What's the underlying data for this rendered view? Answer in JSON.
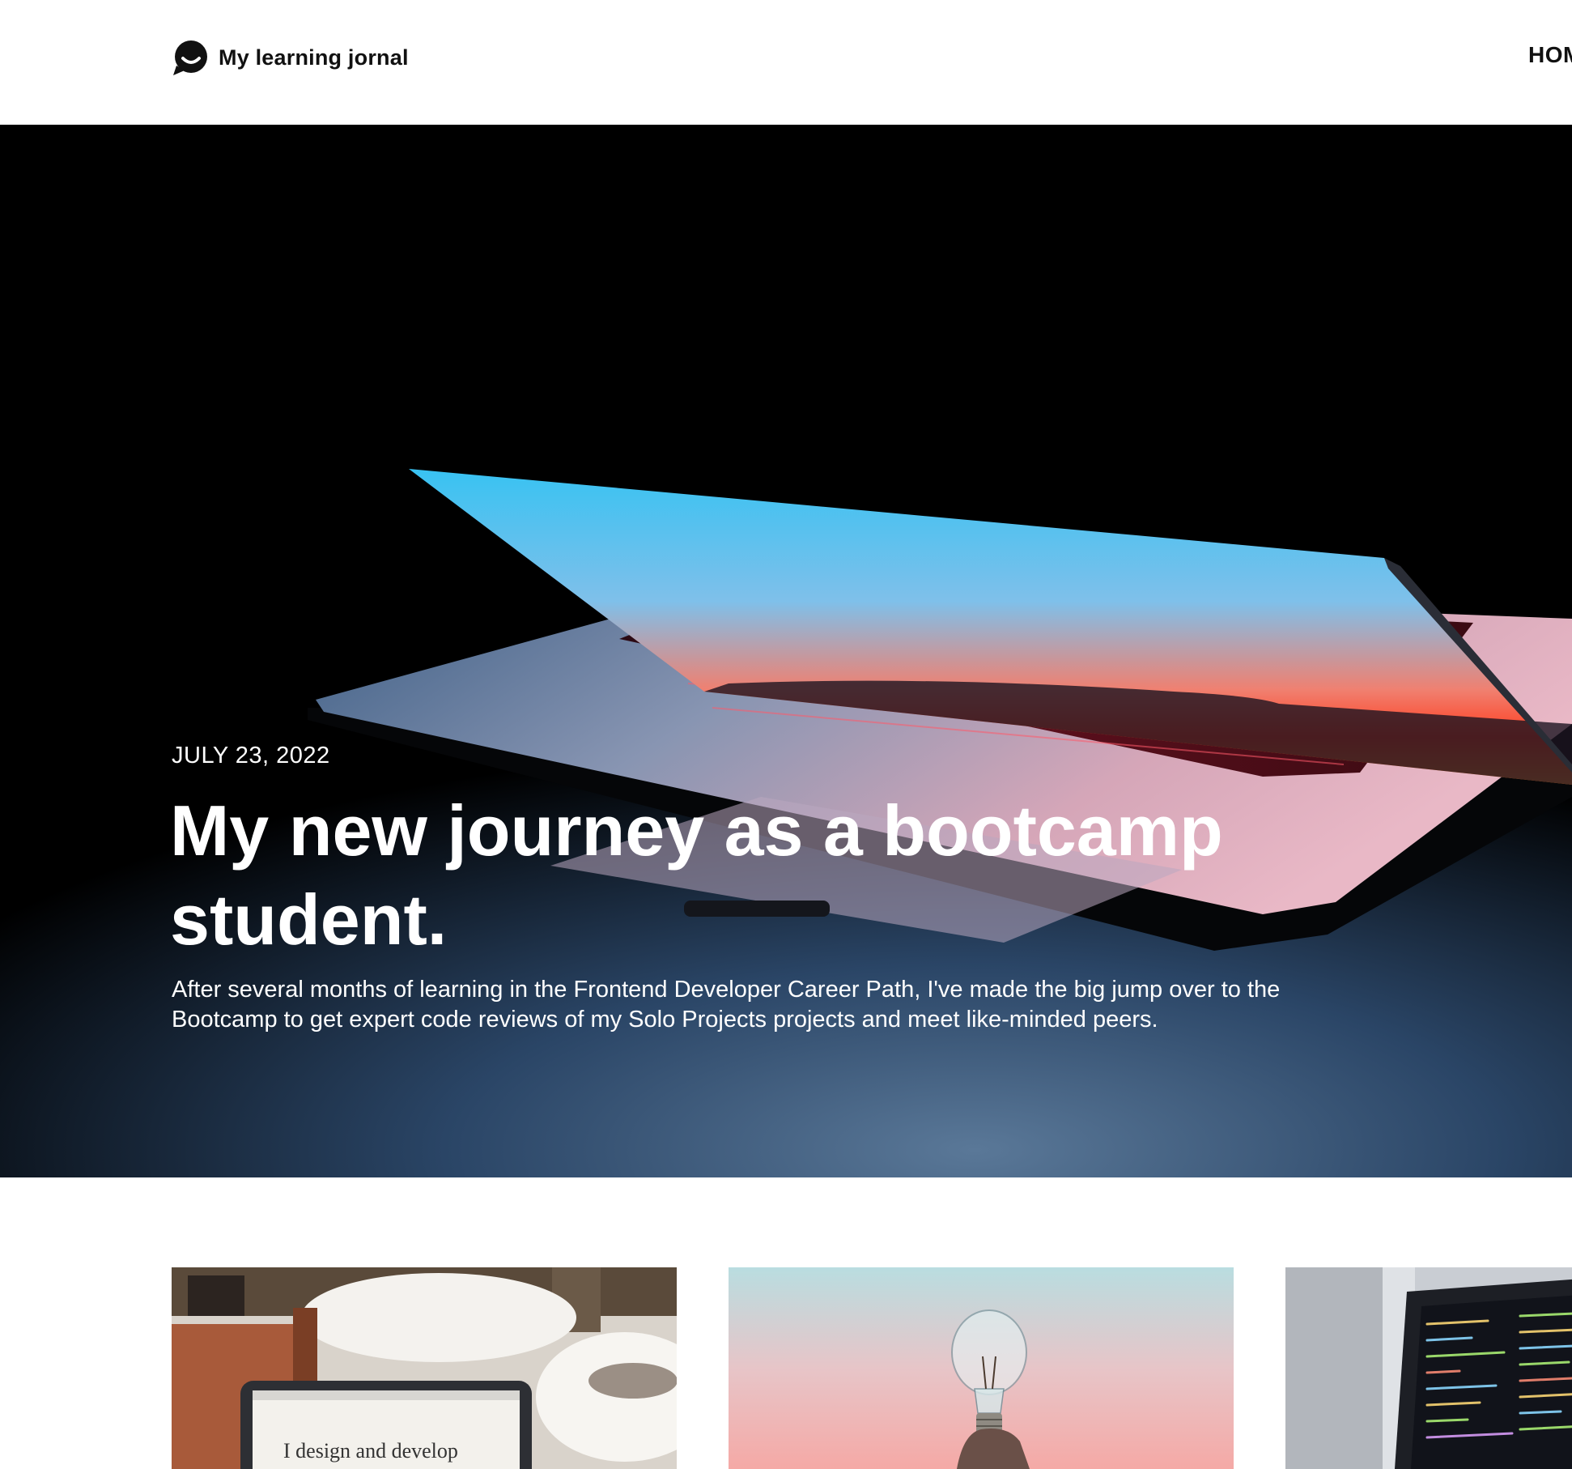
{
  "header": {
    "logo_icon": "chat-bubble-smile-icon",
    "logo_text": "My learning jornal",
    "nav": [
      {
        "label": "HOM"
      }
    ]
  },
  "hero": {
    "date": "JULY 23, 2022",
    "title": "My new journey as a bootcamp student.",
    "description": "After several months of learning in the Frontend Developer Career Path, I've made the big jump over to the Bootcamp to get expert code reviews of my Solo Projects projects and meet like-minded peers.",
    "image_subject": "open laptop glowing in the dark"
  },
  "cards": [
    {
      "image_subject": "laptop on a table in a cafe",
      "screen_text": "I design and develop"
    },
    {
      "image_subject": "hand holding a light bulb against a pastel sky"
    },
    {
      "image_subject": "laptop showing code in an editor"
    }
  ],
  "colors": {
    "text_dark": "#111111",
    "hero_text": "#ffffff",
    "hero_background": "#000000"
  }
}
